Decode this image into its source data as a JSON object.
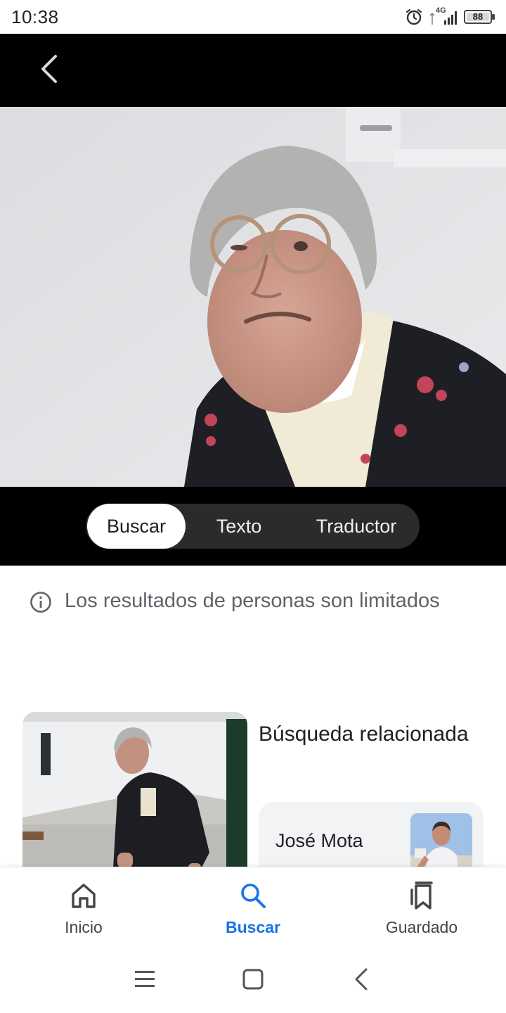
{
  "status_bar": {
    "time": "10:38",
    "network": "4G",
    "battery": "88",
    "icons": [
      "alarm-icon",
      "signal-icon",
      "battery-icon"
    ]
  },
  "top_bar": {
    "back_icon": "chevron-left-icon"
  },
  "mode_tabs": [
    {
      "label": "Buscar",
      "active": true
    },
    {
      "label": "Texto",
      "active": false
    },
    {
      "label": "Traductor",
      "active": false
    }
  ],
  "notice": {
    "icon": "info-icon",
    "text": "Los resultados de personas son limitados"
  },
  "related": {
    "title": "Búsqueda relacionada",
    "chip_label": "José Mota"
  },
  "bottom_nav": [
    {
      "label": "Inicio",
      "icon": "home-icon",
      "active": false
    },
    {
      "label": "Buscar",
      "icon": "search-icon",
      "active": true
    },
    {
      "label": "Guardado",
      "icon": "bookmarks-icon",
      "active": false
    }
  ],
  "colors": {
    "accent": "#1a73e8",
    "top_bar_bg": "#000000",
    "pill_bg": "#2b2b2d",
    "text_secondary": "#5f6368",
    "chip_bg": "#f1f3f4"
  }
}
